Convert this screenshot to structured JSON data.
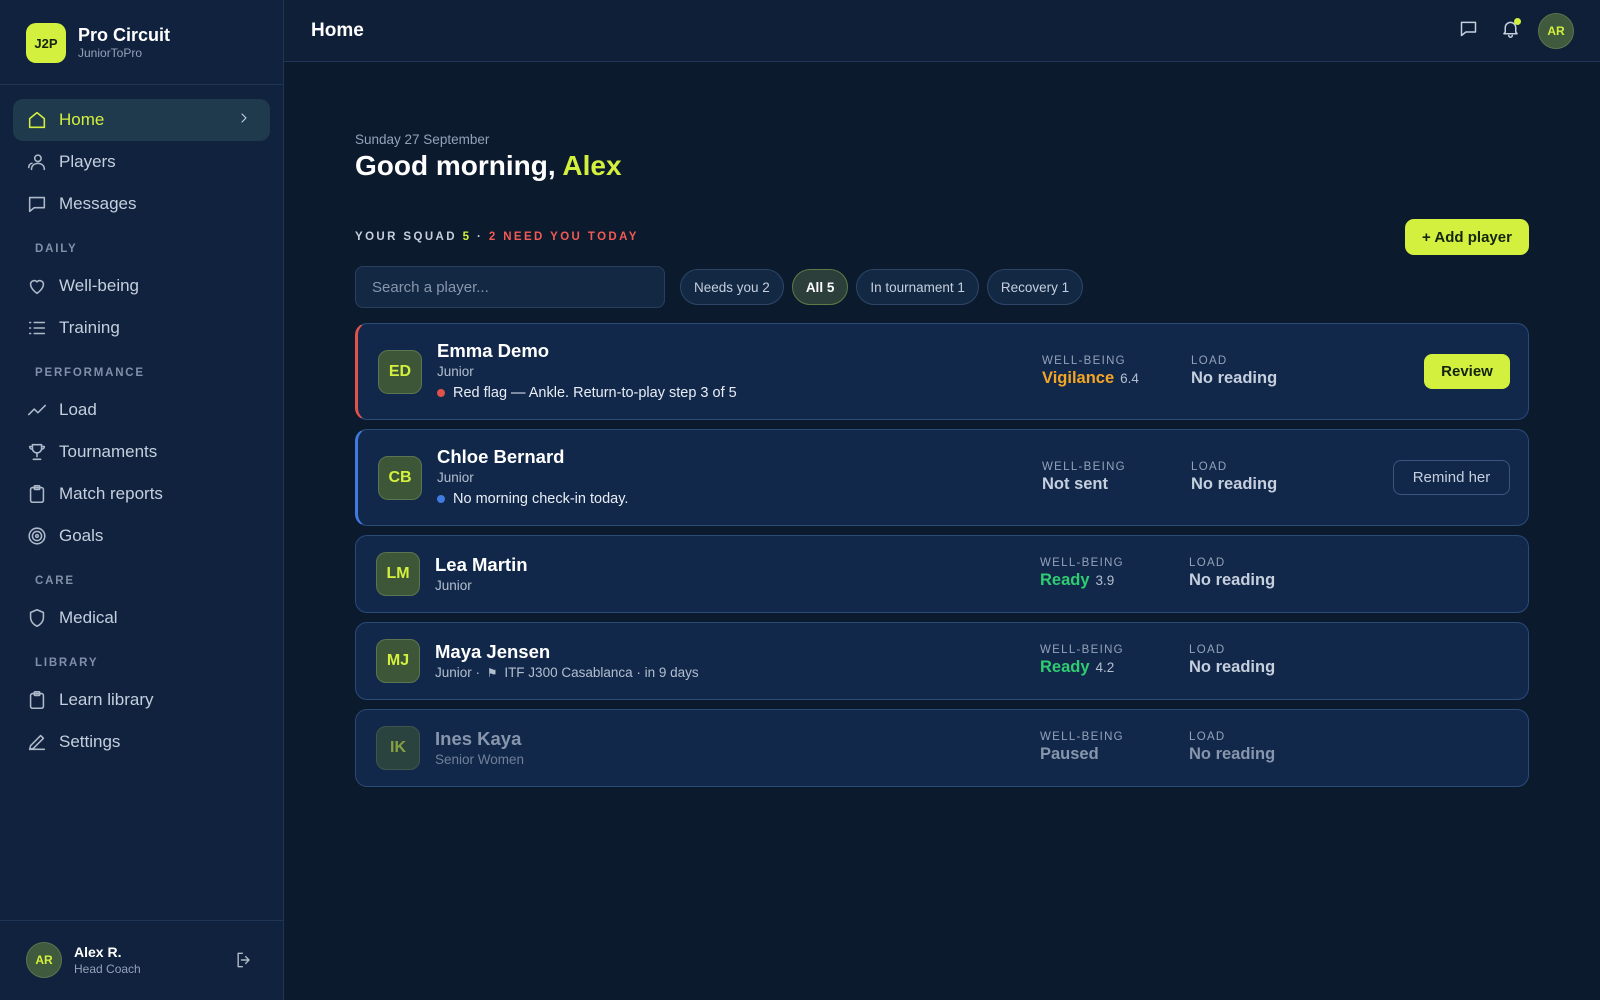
{
  "brand": {
    "logo": "J2P",
    "name": "Pro Circuit",
    "sub": "JuniorToPro"
  },
  "sidebar": {
    "items": [
      {
        "label": "Home",
        "icon": "home-icon"
      },
      {
        "label": "Players",
        "icon": "users-icon"
      },
      {
        "label": "Messages",
        "icon": "message-icon"
      }
    ],
    "sections": [
      {
        "title": "DAILY",
        "items": [
          {
            "label": "Well-being",
            "icon": "heart-icon"
          },
          {
            "label": "Training",
            "icon": "list-icon"
          }
        ]
      },
      {
        "title": "PERFORMANCE",
        "items": [
          {
            "label": "Load",
            "icon": "trend-icon"
          },
          {
            "label": "Tournaments",
            "icon": "trophy-icon"
          },
          {
            "label": "Match reports",
            "icon": "clipboard-icon"
          },
          {
            "label": "Goals",
            "icon": "target-icon"
          }
        ]
      },
      {
        "title": "CARE",
        "items": [
          {
            "label": "Medical",
            "icon": "shield-icon"
          }
        ]
      },
      {
        "title": "LIBRARY",
        "items": [
          {
            "label": "Learn library",
            "icon": "clipboard-icon"
          },
          {
            "label": "Settings",
            "icon": "pen-icon"
          }
        ]
      }
    ]
  },
  "profile": {
    "initials": "AR",
    "name": "Alex R.",
    "role": "Head Coach"
  },
  "topbar": {
    "title": "Home",
    "avatar": "AR"
  },
  "main": {
    "date": "Sunday 27 September",
    "greeting_prefix": "Good morning, ",
    "greeting_name": "Alex",
    "squad_label": "YOUR SQUAD",
    "squad_count": "5",
    "squad_sep": "·",
    "need_text": "2 NEED YOU TODAY",
    "add_label": "+ Add player",
    "search_placeholder": "Search a player...",
    "filters": [
      "Needs you 2",
      "All 5",
      "In tournament 1",
      "Recovery 1"
    ]
  },
  "players": [
    {
      "initials": "ED",
      "name": "Emma Demo",
      "sub": "Junior",
      "note": "Red flag — Ankle. Return-to-play step 3 of 5",
      "wb_label": "WELL-BEING",
      "wb_value": "Vigilance",
      "wb_score": "6.4",
      "load_label": "LOAD",
      "load_value": "No reading",
      "action": "Review"
    },
    {
      "initials": "CB",
      "name": "Chloe Bernard",
      "sub": "Junior",
      "note": "No morning check-in today.",
      "wb_label": "WELL-BEING",
      "wb_value": "Not sent",
      "wb_score": "",
      "load_label": "LOAD",
      "load_value": "No reading",
      "action": "Remind her"
    },
    {
      "initials": "LM",
      "name": "Lea Martin",
      "sub": "Junior",
      "wb_label": "WELL-BEING",
      "wb_value": "Ready",
      "wb_score": "3.9",
      "load_label": "LOAD",
      "load_value": "No reading"
    },
    {
      "initials": "MJ",
      "name": "Maya Jensen",
      "sub_prefix": "Junior ·",
      "sub_flag": "⚑",
      "sub_suffix": "ITF J300 Casablanca · in 9 days",
      "wb_label": "WELL-BEING",
      "wb_value": "Ready",
      "wb_score": "4.2",
      "load_label": "LOAD",
      "load_value": "No reading"
    },
    {
      "initials": "IK",
      "name": "Ines Kaya",
      "sub": "Senior Women",
      "wb_label": "WELL-BEING",
      "wb_value": "Paused",
      "wb_score": "",
      "load_label": "LOAD",
      "load_value": "No reading"
    }
  ],
  "colors": {
    "accent": "#d4f03e",
    "alert": "#e0534d",
    "info": "#3f7be0",
    "ready": "#2fcc71",
    "vigilance": "#f5a524"
  }
}
